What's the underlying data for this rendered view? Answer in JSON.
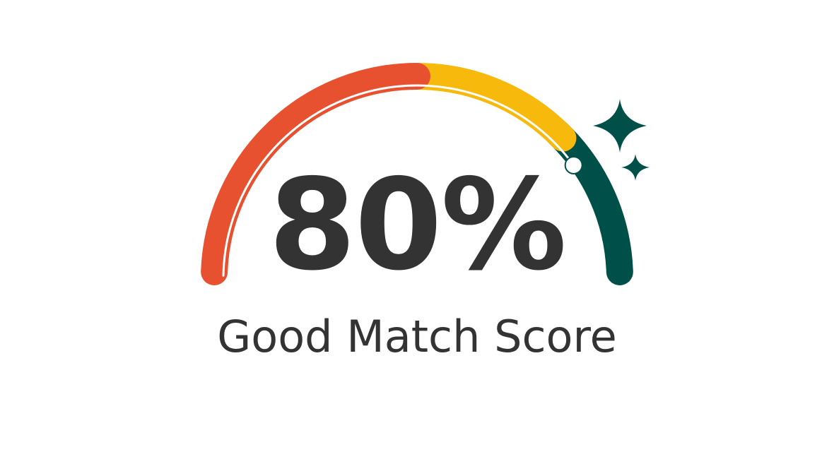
{
  "gauge": {
    "score_text": "80%",
    "label": "Good Match Score",
    "level_fraction": 0.8,
    "segments": [
      {
        "name": "low",
        "color": "#E8512F"
      },
      {
        "name": "medium",
        "color": "#F6B90C"
      },
      {
        "name": "high",
        "color": "#00504A"
      }
    ],
    "indicator_color": "#FFFFFF",
    "text_color": "#333333",
    "sparkle_color": "#00504A",
    "sparkle_icon": "sparkle-icon"
  }
}
